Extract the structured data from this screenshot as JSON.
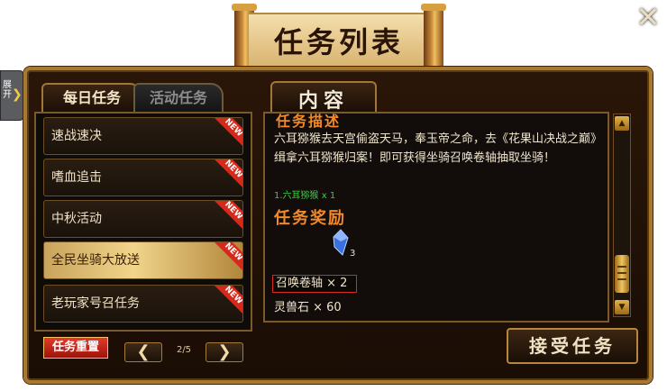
{
  "window": {
    "title": "任务列表",
    "close_label": "✕"
  },
  "side_tab": {
    "label": "展开",
    "arrow": "❯"
  },
  "tabs": [
    {
      "label": "每日任务",
      "active": true
    },
    {
      "label": "活动任务",
      "active": false
    }
  ],
  "task_list": [
    {
      "label": "速战速决",
      "badge": "NEW",
      "selected": false
    },
    {
      "label": "嗜血追击",
      "badge": "NEW",
      "selected": false
    },
    {
      "label": "中秋活动",
      "badge": "NEW",
      "selected": false
    },
    {
      "label": "全民坐骑大放送",
      "badge": "NEW",
      "selected": true
    },
    {
      "label": "老玩家号召任务",
      "badge": "NEW",
      "selected": false
    }
  ],
  "controls": {
    "reset_label": "任务重置",
    "prev_label": "❮",
    "next_label": "❯",
    "page_indicator": "2/5"
  },
  "content": {
    "tab_label": "内容",
    "section_title": "任务描述",
    "description": "六耳猕猴去天宫偷盗天马，奉玉帝之命，去《花果山决战之巅》缉拿六耳猕猴归案！即可获得坐骑召唤卷轴抽取坐骑！",
    "target": "1.六耳猕猴 x 1",
    "reward_title": "任务奖励",
    "reward_item_qty": "3",
    "rewards": [
      "召唤卷轴 × 2",
      "灵兽石 × 60"
    ]
  },
  "accept_label": "接受任务",
  "colors": {
    "accent_orange": "#f08a2a",
    "target_green": "#43c84a",
    "gold_border": "#a8782e"
  },
  "icons": [
    "close-icon",
    "chevron-right-icon",
    "chevron-left-icon",
    "crystal-icon",
    "arrow-up-icon",
    "arrow-down-icon"
  ]
}
